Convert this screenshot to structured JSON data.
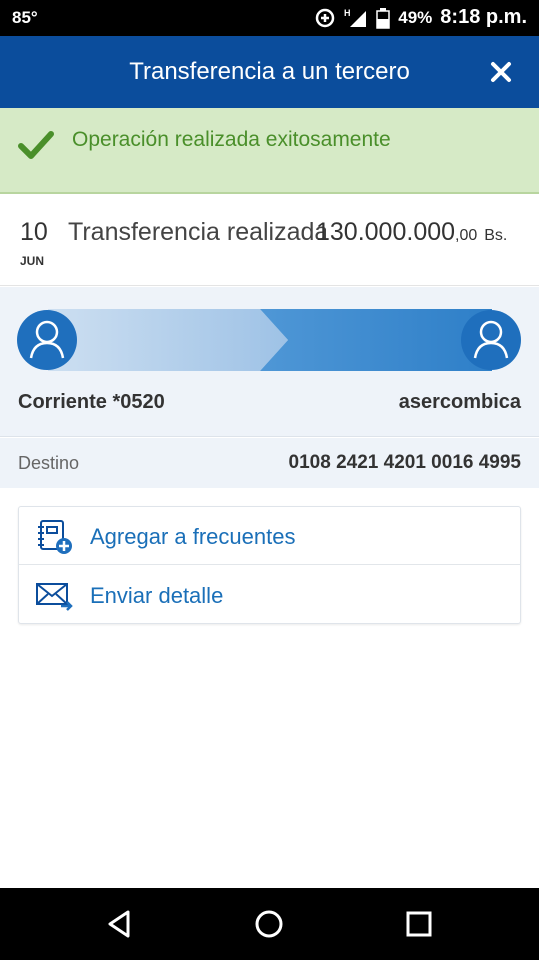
{
  "status_bar": {
    "temperature": "85°",
    "battery_percent": "49%",
    "time": "8:18 p.m.",
    "icons": [
      "data-saver-icon",
      "signal-icon",
      "battery-icon"
    ]
  },
  "header": {
    "title": "Transferencia a un tercero",
    "close_icon": "close-icon"
  },
  "alert": {
    "message": "Operación realizada exitosamente",
    "icon": "check-icon",
    "color": "#4a8f2a"
  },
  "transaction": {
    "day": "10",
    "month": "JUN",
    "description": "Transferencia realizada",
    "amount_integer": "130.000.000",
    "amount_decimal": ",00",
    "currency": "Bs."
  },
  "transfer": {
    "from_account": "Corriente *0520",
    "to_account": "asercombica",
    "avatar_icon": "user-avatar-icon"
  },
  "destination": {
    "label": "Destino",
    "value": "0108 2421 4201 0016 4995"
  },
  "actions": [
    {
      "label": "Agregar a frecuentes",
      "icon": "add-contact-icon"
    },
    {
      "label": "Enviar detalle",
      "icon": "send-mail-icon"
    }
  ],
  "nav_bar": {
    "icons": [
      "back-icon",
      "home-icon",
      "recents-icon"
    ]
  },
  "colors": {
    "brand_blue": "#0b4d9c",
    "success_bg": "#d6eac6",
    "link_blue": "#1a6fb8"
  }
}
